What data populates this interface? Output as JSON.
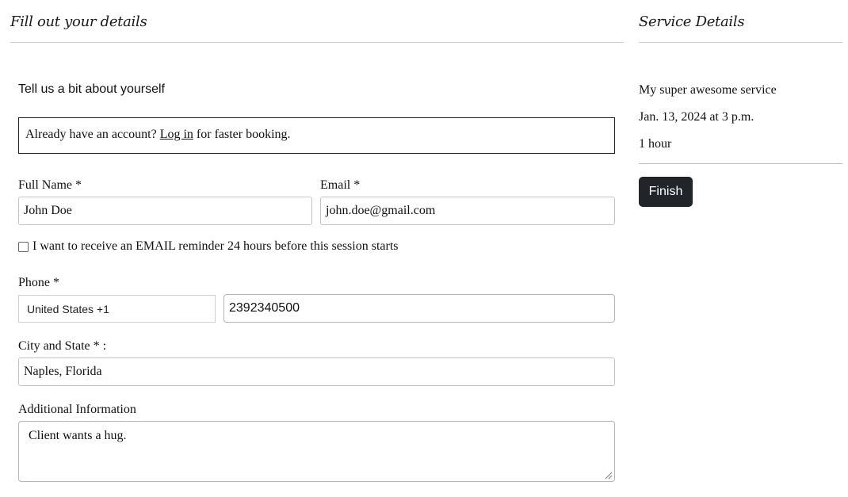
{
  "form": {
    "title": "Fill out your details",
    "subheading": "Tell us a bit about yourself",
    "notice": {
      "prefix": "Already have an account? ",
      "link": "Log in",
      "suffix": " for faster booking."
    },
    "full_name": {
      "label": "Full Name *",
      "value": "John Doe"
    },
    "email": {
      "label": "Email *",
      "value": "john.doe@gmail.com"
    },
    "reminder_checkbox": {
      "label": "I want to receive an EMAIL reminder 24 hours before this session starts",
      "checked": false
    },
    "phone": {
      "label": "Phone *",
      "country": "United States +1",
      "number": "2392340500"
    },
    "city_state": {
      "label": "City and State * :",
      "value": "Naples, Florida"
    },
    "additional_info": {
      "label": "Additional Information",
      "value": "Client wants a hug."
    }
  },
  "service": {
    "title": "Service Details",
    "name": "My super awesome service",
    "datetime": "Jan. 13, 2024 at 3 p.m.",
    "duration": "1 hour",
    "finish_label": "Finish"
  },
  "colors": {
    "button_bg": "#212529",
    "button_text": "#ffffff"
  }
}
